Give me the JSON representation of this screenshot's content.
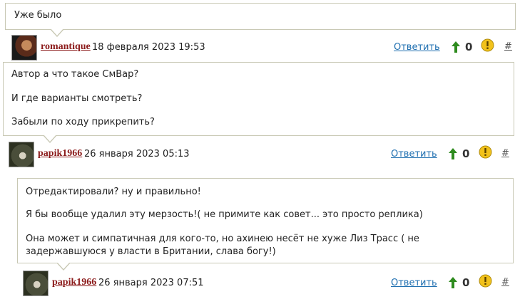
{
  "comments": [
    {
      "text_lines": [
        "Уже было"
      ],
      "author": "romantique",
      "date": "18 февраля 2023 19:53",
      "reply_label": "Ответить",
      "score": "0",
      "permalink": "#"
    },
    {
      "text_lines": [
        "Автор а что такое СмВар?",
        "И где варианты смотреть?",
        "Забыли по ходу прикрепить?"
      ],
      "author": "papik1966",
      "date": "26 января 2023 05:13",
      "reply_label": "Ответить",
      "score": "0",
      "permalink": "#"
    },
    {
      "text_lines": [
        "Отредактировали? ну и правильно!",
        "Я бы вообще удалил эту мерзость!( не примите как совет... это просто реплика)",
        "Она может и симпатичная для кого-то, но ахинею несёт не хуже Лиз Трасс ( не задержавшуюся у власти в Британии, слава богу!)"
      ],
      "author": "papik1966",
      "date": "26 января 2023 07:51",
      "reply_label": "Ответить",
      "score": "0",
      "permalink": "#"
    }
  ],
  "icons": {
    "upvote": "arrow-up-icon",
    "report": "exclamation-icon",
    "upvote_color": "#2e8b1e",
    "report_color": "#f2c21b"
  }
}
